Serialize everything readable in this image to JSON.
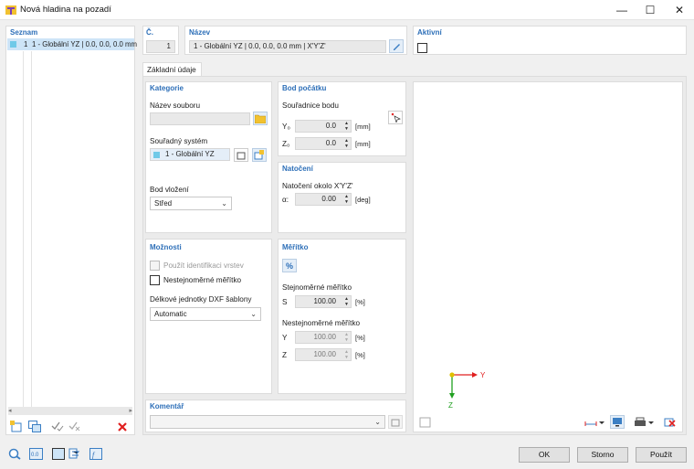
{
  "window": {
    "title": "Nová hladina na pozadí",
    "minimize": "—",
    "maximize": "☐",
    "close": "✕"
  },
  "list": {
    "header": "Seznam",
    "items": [
      {
        "number": "1",
        "label": "1 - Globální YZ | 0.0, 0.0, 0.0 mm"
      }
    ]
  },
  "top": {
    "no_label": "Č.",
    "no_value": "1",
    "name_label": "Název",
    "name_value": "1 - Globální YZ | 0.0, 0.0, 0.0 mm | X'Y'Z'",
    "active_label": "Aktivní"
  },
  "tabs": [
    {
      "label": "Základní údaje"
    }
  ],
  "category": {
    "header": "Kategorie",
    "filename_label": "Název souboru",
    "filename_value": "",
    "cs_label": "Souřadný systém",
    "cs_value": "1 - Globální YZ",
    "insert_label": "Bod vložení",
    "insert_value": "Střed"
  },
  "origin": {
    "header": "Bod počátku",
    "coords_label": "Souřadnice bodu",
    "y_label": "Y₀",
    "y_value": "0.0",
    "y_unit": "[mm]",
    "z_label": "Z₀",
    "z_value": "0.0",
    "z_unit": "[mm]"
  },
  "rotation": {
    "header": "Natočení",
    "about_label": "Natočení okolo X'Y'Z'",
    "alpha_label": "α:",
    "alpha_value": "0.00",
    "alpha_unit": "[deg]"
  },
  "options": {
    "header": "Možnosti",
    "layer_id_label": "Použít identifikaci vrstev",
    "nonuniform_label": "Nestejnoměrné měřítko",
    "units_label": "Délkové jednotky DXF šablony",
    "units_value": "Automatic"
  },
  "scale": {
    "header": "Měřítko",
    "percent_label": "%",
    "uniform_label": "Stejnoměrné měřítko",
    "s_label": "S",
    "s_value": "100.00",
    "s_unit": "[%]",
    "nonuniform_label": "Nestejnoměrné měřítko",
    "y_label": "Y",
    "y_value": "100.00",
    "y_unit": "[%]",
    "z_label": "Z",
    "z_value": "100.00",
    "z_unit": "[%]"
  },
  "comment": {
    "header": "Komentář",
    "value": ""
  },
  "preview": {
    "axis_y": "Y",
    "axis_z": "Z"
  },
  "buttons": {
    "ok": "OK",
    "cancel": "Storno",
    "apply": "Použít"
  },
  "colors": {
    "accent": "#2d6fb8",
    "axis_y": "#e02020",
    "axis_z": "#20a020",
    "origin": "#e0c000"
  },
  "icons": {
    "maximize": "maximize-icon",
    "minimize": "minimize-icon",
    "close": "close-icon",
    "folder": "folder-icon",
    "pick_point": "pick-point-icon",
    "delete": "delete-icon"
  }
}
